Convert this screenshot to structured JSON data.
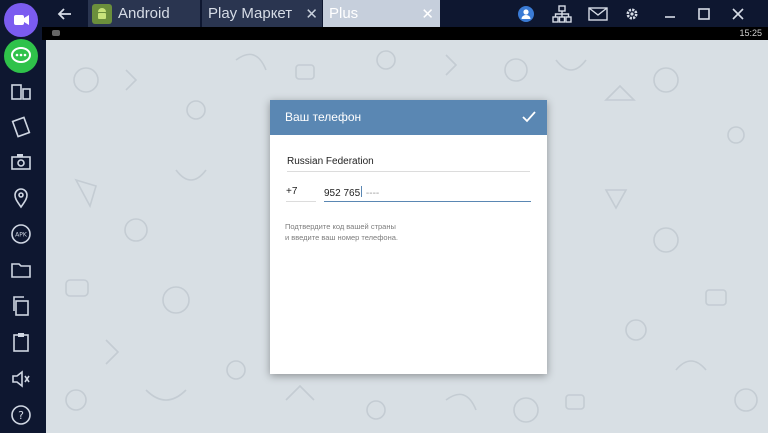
{
  "titlebar": {
    "tabs": [
      {
        "label": "Android",
        "icon": "android-icon",
        "active": false
      },
      {
        "label": "Play Маркет",
        "icon": "",
        "active": false
      },
      {
        "label": "Plus",
        "icon": "",
        "active": true
      }
    ],
    "right_icons": [
      "user-icon",
      "network-icon",
      "mail-icon",
      "gear-icon",
      "minimize-icon",
      "maximize-icon",
      "close-icon"
    ]
  },
  "statusbar": {
    "time": "15:25"
  },
  "sidebar": {
    "items": [
      "video-call-icon",
      "chat-icon",
      "multi-window-icon",
      "rotate-icon",
      "camera-icon",
      "location-icon",
      "apk-icon",
      "folder-icon",
      "copy-icon",
      "clipboard-icon",
      "volume-icon",
      "help-icon"
    ]
  },
  "dialog": {
    "title": "Ваш телефон",
    "country": "Russian Federation",
    "code": "+7",
    "phone_typed": "952 765",
    "phone_mask": " ----",
    "hint_line1": "Подтвердите код вашей страны",
    "hint_line2": "и введите ваш номер телефона."
  },
  "colors": {
    "header": "#5a87b3",
    "screen_bg": "#d8dfe4",
    "chrome_bg": "#0e1730"
  }
}
